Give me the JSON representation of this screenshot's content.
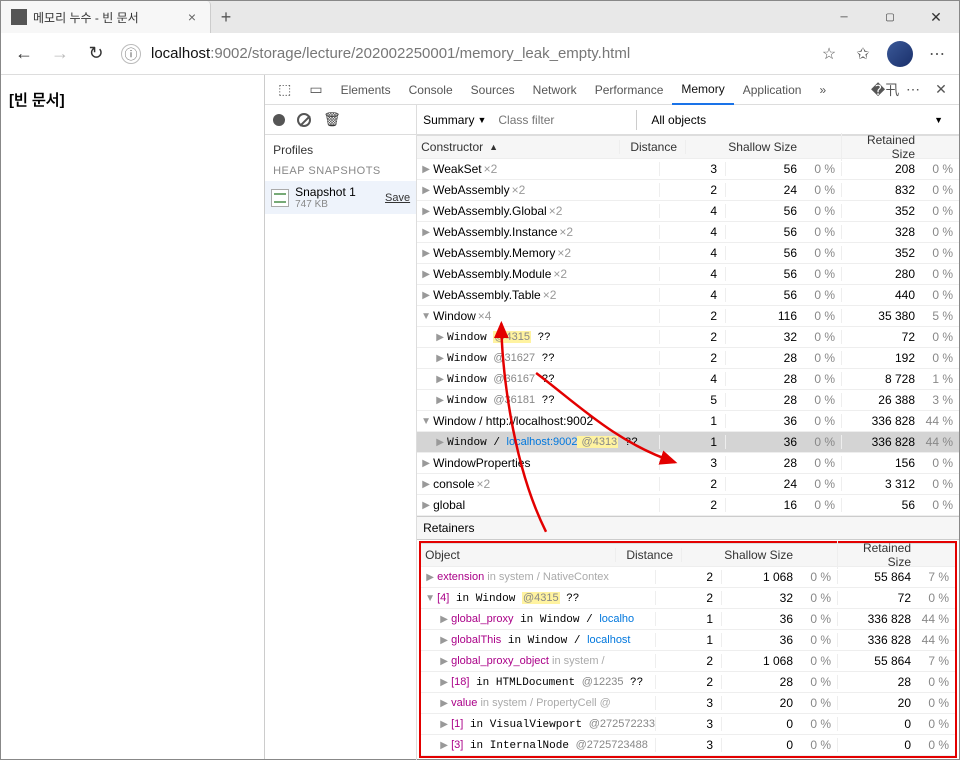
{
  "window": {
    "tab_title": "메모리 누수 - 빈 문서",
    "close": "×",
    "new_tab": "+"
  },
  "nav": {
    "back": "←",
    "forward": "→",
    "reload": "↻",
    "info": "ⓘ",
    "url_pre": "localhost",
    "url_host": ":9002/storage/lecture/202002250001/memory_leak_empty.html",
    "star": "☆",
    "fav": "✩",
    "more": "⋯"
  },
  "page": {
    "title": "[빈 문서]"
  },
  "dt": {
    "tabs": [
      "Elements",
      "Console",
      "Sources",
      "Network",
      "Performance",
      "Memory",
      "Application"
    ],
    "active": "Memory",
    "more": "»",
    "settings": "⚙",
    "dots": "⋯",
    "close": "✕",
    "toolbar_icons": [
      "inspect",
      "device"
    ]
  },
  "left": {
    "profiles": "Profiles",
    "heap": "HEAP SNAPSHOTS",
    "snapshot": {
      "name": "Snapshot 1",
      "size": "747 KB",
      "save": "Save"
    }
  },
  "filter": {
    "summary": "Summary",
    "class_ph": "Class filter",
    "all": "All objects"
  },
  "cols": {
    "constructor": "Constructor",
    "distance": "Distance",
    "shallow": "Shallow Size",
    "retained": "Retained Size"
  },
  "rows": [
    {
      "tw": "▶",
      "name": "WeakSet",
      "mult": "×2",
      "d": 3,
      "s": 56,
      "sp": "0 %",
      "r": 208,
      "rp": "0 %",
      "pad": 0
    },
    {
      "tw": "▶",
      "name": "WebAssembly",
      "mult": "×2",
      "d": 2,
      "s": 24,
      "sp": "0 %",
      "r": 832,
      "rp": "0 %",
      "pad": 0
    },
    {
      "tw": "▶",
      "name": "WebAssembly.Global",
      "mult": "×2",
      "d": 4,
      "s": 56,
      "sp": "0 %",
      "r": 352,
      "rp": "0 %",
      "pad": 0
    },
    {
      "tw": "▶",
      "name": "WebAssembly.Instance",
      "mult": "×2",
      "d": 4,
      "s": 56,
      "sp": "0 %",
      "r": 328,
      "rp": "0 %",
      "pad": 0
    },
    {
      "tw": "▶",
      "name": "WebAssembly.Memory",
      "mult": "×2",
      "d": 4,
      "s": 56,
      "sp": "0 %",
      "r": 352,
      "rp": "0 %",
      "pad": 0
    },
    {
      "tw": "▶",
      "name": "WebAssembly.Module",
      "mult": "×2",
      "d": 4,
      "s": 56,
      "sp": "0 %",
      "r": 280,
      "rp": "0 %",
      "pad": 0
    },
    {
      "tw": "▶",
      "name": "WebAssembly.Table",
      "mult": "×2",
      "d": 4,
      "s": 56,
      "sp": "0 %",
      "r": 440,
      "rp": "0 %",
      "pad": 0
    },
    {
      "tw": "▼",
      "name": "Window",
      "mult": "×4",
      "d": 2,
      "s": 116,
      "sp": "0 %",
      "r": "35 380",
      "rp": "5 %",
      "pad": 0
    },
    {
      "tw": "▶",
      "mono": true,
      "name": "Window ",
      "addr": "@4315",
      "suff": " ??",
      "hl": true,
      "d": 2,
      "s": 32,
      "sp": "0 %",
      "r": 72,
      "rp": "0 %",
      "pad": 1
    },
    {
      "tw": "▶",
      "mono": true,
      "name": "Window ",
      "addr": "@31627",
      "suff": " ??",
      "d": 2,
      "s": 28,
      "sp": "0 %",
      "r": 192,
      "rp": "0 %",
      "pad": 1
    },
    {
      "tw": "▶",
      "mono": true,
      "name": "Window ",
      "addr": "@36167",
      "suff": " ??",
      "d": 4,
      "s": 28,
      "sp": "0 %",
      "r": "8 728",
      "rp": "1 %",
      "pad": 1
    },
    {
      "tw": "▶",
      "mono": true,
      "name": "Window ",
      "addr": "@36181",
      "suff": " ??",
      "d": 5,
      "s": 28,
      "sp": "0 %",
      "r": "26 388",
      "rp": "3 %",
      "pad": 1
    },
    {
      "tw": "▼",
      "name": "Window / http://localhost:9002",
      "d": 1,
      "s": 36,
      "sp": "0 %",
      "r": "336 828",
      "rp": "44 %",
      "pad": 0
    },
    {
      "tw": "▶",
      "mono": true,
      "name": "Window / ",
      "link": "localhost:9002",
      "addr": " @4313",
      "suff": " ??",
      "d": 1,
      "s": 36,
      "sp": "0 %",
      "r": "336 828",
      "rp": "44 %",
      "pad": 1,
      "sel": true,
      "hl": true
    },
    {
      "tw": "▶",
      "name": "WindowProperties",
      "d": 3,
      "s": 28,
      "sp": "0 %",
      "r": 156,
      "rp": "0 %",
      "pad": 0
    },
    {
      "tw": "▶",
      "name": "console",
      "mult": "×2",
      "d": 2,
      "s": 24,
      "sp": "0 %",
      "r": "3 312",
      "rp": "0 %",
      "pad": 0
    },
    {
      "tw": "▶",
      "name": "global",
      "d": 2,
      "s": 16,
      "sp": "0 %",
      "r": 56,
      "rp": "0 %",
      "pad": 0
    }
  ],
  "ret": {
    "title": "Retainers",
    "cols": {
      "object": "Object",
      "distance": "Distance",
      "shallow": "Shallow Size",
      "retained": "Retained Size"
    },
    "rows": [
      {
        "tw": "▶",
        "txt": "extension",
        "sys": " in system / NativeContex",
        "d": 2,
        "s": "1 068",
        "sp": "0 %",
        "r": "55 864",
        "rp": "7 %"
      },
      {
        "tw": "▼",
        "txt": "[4]",
        "plain": " in Window ",
        "addr": "@4315",
        "suff": " ??",
        "hl": true,
        "d": 2,
        "s": 32,
        "sp": "0 %",
        "r": 72,
        "rp": "0 %"
      },
      {
        "tw": "▶",
        "pad": 1,
        "txt": "global_proxy",
        "plain": " in Window / ",
        "link": "localho",
        "d": 1,
        "s": 36,
        "sp": "0 %",
        "r": "336 828",
        "rp": "44 %"
      },
      {
        "tw": "▶",
        "pad": 1,
        "txt": "globalThis",
        "plain": " in Window / ",
        "link": "localhost",
        "d": 1,
        "s": 36,
        "sp": "0 %",
        "r": "336 828",
        "rp": "44 %"
      },
      {
        "tw": "▶",
        "pad": 1,
        "txt": "global_proxy_object",
        "sys": " in system /",
        "d": 2,
        "s": "1 068",
        "sp": "0 %",
        "r": "55 864",
        "rp": "7 %"
      },
      {
        "tw": "▶",
        "pad": 1,
        "txt": "[18]",
        "plain": " in HTMLDocument ",
        "addr": "@12235",
        "suff": " ??",
        "d": 2,
        "s": 28,
        "sp": "0 %",
        "r": 28,
        "rp": "0 %"
      },
      {
        "tw": "▶",
        "pad": 1,
        "txt": "value",
        "sys": " in system / PropertyCell @",
        "d": 3,
        "s": 20,
        "sp": "0 %",
        "r": 20,
        "rp": "0 %"
      },
      {
        "tw": "▶",
        "pad": 1,
        "txt": "[1]",
        "plain": " in VisualViewport ",
        "addr": "@272572233",
        "d": 3,
        "s": 0,
        "sp": "0 %",
        "r": 0,
        "rp": "0 %"
      },
      {
        "tw": "▶",
        "pad": 1,
        "txt": "[3]",
        "plain": " in InternalNode ",
        "addr": "@2725723488",
        "d": 3,
        "s": 0,
        "sp": "0 %",
        "r": 0,
        "rp": "0 %"
      }
    ]
  }
}
